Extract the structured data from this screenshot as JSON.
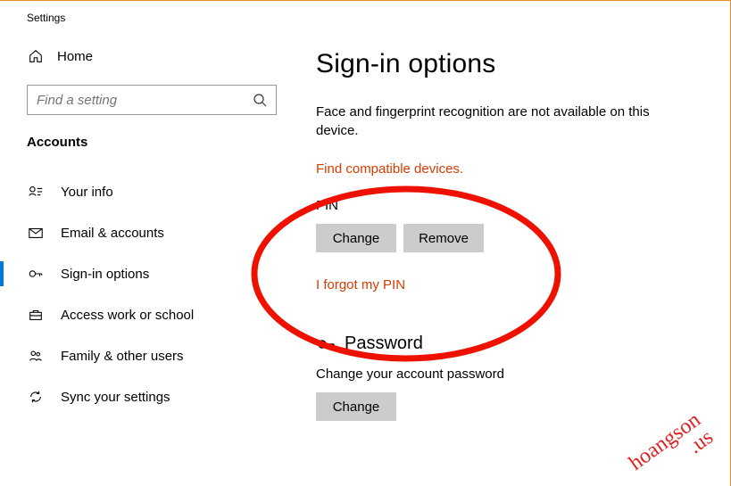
{
  "window": {
    "title": "Settings"
  },
  "sidebar": {
    "home": "Home",
    "search_placeholder": "Find a setting",
    "section": "Accounts",
    "items": [
      {
        "label": "Your info"
      },
      {
        "label": "Email & accounts"
      },
      {
        "label": "Sign-in options"
      },
      {
        "label": "Access work or school"
      },
      {
        "label": "Family & other users"
      },
      {
        "label": "Sync your settings"
      }
    ]
  },
  "main": {
    "title": "Sign-in options",
    "hello_unavailable": "Face and fingerprint recognition are not available on this device.",
    "find_devices": "Find compatible devices.",
    "pin_head": "PIN",
    "pin_change": "Change",
    "pin_remove": "Remove",
    "forgot_pin": "I forgot my PIN",
    "password_head": "Password",
    "password_desc": "Change your account password",
    "password_change": "Change"
  },
  "watermark": {
    "line1": "hoangson",
    "line2": ".us"
  }
}
